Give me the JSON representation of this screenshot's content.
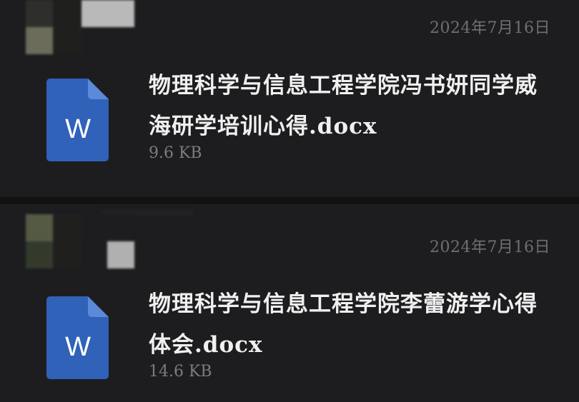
{
  "messages": [
    {
      "date": "2024年7月16日",
      "file": {
        "name": "物理科学与信息工程学院冯书妍同学威海研学培训心得.docx",
        "size": "9.6 KB",
        "icon": "word-document-icon",
        "icon_letter": "W"
      }
    },
    {
      "date": "2024年7月16日",
      "file": {
        "name": "物理科学与信息工程学院李蕾游学心得体会.docx",
        "size": "14.6 KB",
        "icon": "word-document-icon",
        "icon_letter": "W"
      }
    }
  ],
  "colors": {
    "background": "#1d1d1f",
    "divider": "#121213",
    "word_blue": "#2f62b8",
    "word_fold": "#5a8ad8",
    "text_primary": "#f0f0f0",
    "text_secondary": "#7c7c7f"
  }
}
